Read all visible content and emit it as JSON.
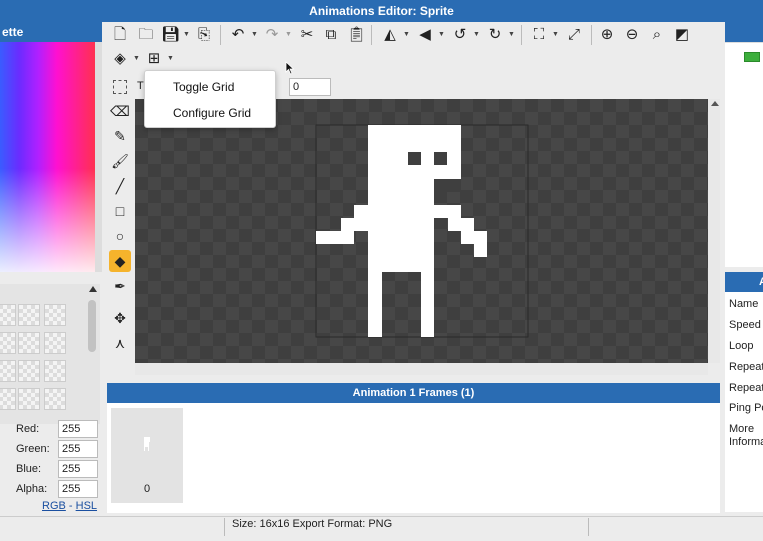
{
  "window": {
    "title": "Animations Editor: Sprite"
  },
  "palette": {
    "header": "ette",
    "red_label": "Red:",
    "red_value": "255",
    "green_label": "Green:",
    "green_value": "255",
    "blue_label": "Blue:",
    "blue_value": "255",
    "alpha_label": "Alpha:",
    "alpha_value": "255",
    "mode_rgb": "RGB",
    "mode_sep": " - ",
    "mode_hsl": "HSL"
  },
  "toolbar": {
    "icons": [
      "new-file-icon",
      "open-folder-icon",
      "save-icon",
      "export-icon",
      "undo-icon",
      "redo-icon",
      "cut-icon",
      "copy-icon",
      "paste-icon",
      "flip-horizontal-icon",
      "flip-vertical-icon",
      "rotate-left-icon",
      "rotate-right-icon",
      "crop-icon",
      "resize-icon",
      "zoom-in-icon",
      "zoom-out-icon",
      "zoom-fit-icon",
      "invert-icon",
      "layers-icon",
      "grid-icon"
    ]
  },
  "tool_options": {
    "label": "T",
    "value": "0"
  },
  "grid_menu": {
    "items": [
      "Toggle Grid",
      "Configure Grid"
    ]
  },
  "tools": [
    "select-tool",
    "eraser-tool",
    "pencil-tool",
    "brush-tool",
    "line-tool",
    "rectangle-tool",
    "ellipse-tool",
    "fill-tool",
    "eyedropper-tool",
    "move-tool",
    "vertex-tool"
  ],
  "active_tool": "fill-tool",
  "frames": {
    "header": "Animation 1 Frames (1)",
    "frame_number": "0"
  },
  "properties": {
    "header": "A",
    "items": [
      "Name",
      "Speed",
      "Loop",
      "Repeat",
      "Repeat",
      "Ping Po",
      "More",
      "Informa"
    ]
  },
  "status": {
    "text": "Size: 16x16  Export Format: PNG"
  },
  "colors": {
    "accent": "#2a6cb3",
    "active_tool": "#f5b32c",
    "canvas": "#3f3f3f"
  }
}
